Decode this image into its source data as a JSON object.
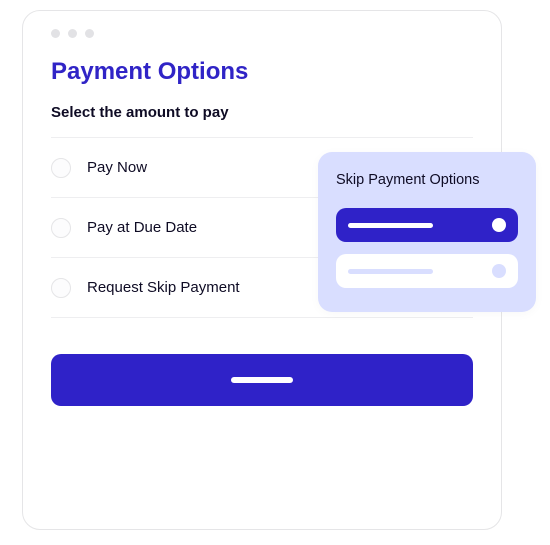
{
  "header": {
    "title": "Payment Options",
    "subtitle": "Select the amount to pay"
  },
  "options": [
    {
      "label": "Pay Now"
    },
    {
      "label": "Pay at Due Date"
    },
    {
      "label": "Request Skip Payment"
    }
  ],
  "popup": {
    "title": "Skip Payment Options"
  },
  "colors": {
    "primary": "#2f22c8",
    "popup_bg": "#d9deff"
  }
}
